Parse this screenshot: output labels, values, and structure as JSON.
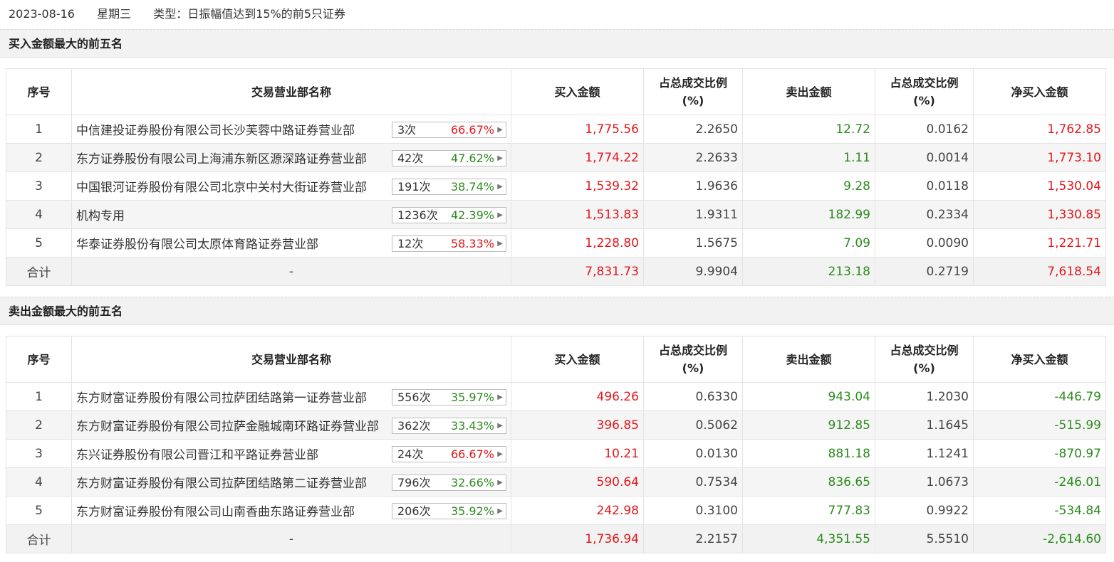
{
  "header": {
    "date": "2023-08-16",
    "weekday": "星期三",
    "type_text": "类型：日振幅值达到15%的前5只证券"
  },
  "columns": {
    "seq": "序号",
    "dept": "交易营业部名称",
    "buy_amt": "买入金额",
    "buy_ratio_l1": "占总成交比例",
    "buy_ratio_l2": "(%)",
    "sell_amt": "卖出金额",
    "sell_ratio_l1": "占总成交比例",
    "sell_ratio_l2": "(%)",
    "net": "净买入金额"
  },
  "buy_section": {
    "title": "买入金额最大的前五名",
    "rows": [
      {
        "seq": "1",
        "name": "中信建投证券股份有限公司长沙芙蓉中路证券营业部",
        "count": "3次",
        "pct": "66.67%",
        "pct_color": "red",
        "buy": "1,775.56",
        "buy_ratio": "2.2650",
        "sell": "12.72",
        "sell_ratio": "0.0162",
        "net": "1,762.85"
      },
      {
        "seq": "2",
        "name": "东方证券股份有限公司上海浦东新区源深路证券营业部",
        "count": "42次",
        "pct": "47.62%",
        "pct_color": "green",
        "buy": "1,774.22",
        "buy_ratio": "2.2633",
        "sell": "1.11",
        "sell_ratio": "0.0014",
        "net": "1,773.10"
      },
      {
        "seq": "3",
        "name": "中国银河证券股份有限公司北京中关村大街证券营业部",
        "count": "191次",
        "pct": "38.74%",
        "pct_color": "green",
        "buy": "1,539.32",
        "buy_ratio": "1.9636",
        "sell": "9.28",
        "sell_ratio": "0.0118",
        "net": "1,530.04"
      },
      {
        "seq": "4",
        "name": "机构专用",
        "count": "1236次",
        "pct": "42.39%",
        "pct_color": "green",
        "buy": "1,513.83",
        "buy_ratio": "1.9311",
        "sell": "182.99",
        "sell_ratio": "0.2334",
        "net": "1,330.85"
      },
      {
        "seq": "5",
        "name": "华泰证券股份有限公司太原体育路证券营业部",
        "count": "12次",
        "pct": "58.33%",
        "pct_color": "red",
        "buy": "1,228.80",
        "buy_ratio": "1.5675",
        "sell": "7.09",
        "sell_ratio": "0.0090",
        "net": "1,221.71"
      }
    ],
    "total": {
      "label": "合计",
      "name": "-",
      "buy": "7,831.73",
      "buy_ratio": "9.9904",
      "sell": "213.18",
      "sell_ratio": "0.2719",
      "net": "7,618.54"
    }
  },
  "sell_section": {
    "title": "卖出金额最大的前五名",
    "rows": [
      {
        "seq": "1",
        "name": "东方财富证券股份有限公司拉萨团结路第一证券营业部",
        "count": "556次",
        "pct": "35.97%",
        "pct_color": "green",
        "buy": "496.26",
        "buy_ratio": "0.6330",
        "sell": "943.04",
        "sell_ratio": "1.2030",
        "net": "-446.79"
      },
      {
        "seq": "2",
        "name": "东方财富证券股份有限公司拉萨金融城南环路证券营业部",
        "count": "362次",
        "pct": "33.43%",
        "pct_color": "green",
        "buy": "396.85",
        "buy_ratio": "0.5062",
        "sell": "912.85",
        "sell_ratio": "1.1645",
        "net": "-515.99"
      },
      {
        "seq": "3",
        "name": "东兴证券股份有限公司晋江和平路证券营业部",
        "count": "24次",
        "pct": "66.67%",
        "pct_color": "red",
        "buy": "10.21",
        "buy_ratio": "0.0130",
        "sell": "881.18",
        "sell_ratio": "1.1241",
        "net": "-870.97"
      },
      {
        "seq": "4",
        "name": "东方财富证券股份有限公司拉萨团结路第二证券营业部",
        "count": "796次",
        "pct": "32.66%",
        "pct_color": "green",
        "buy": "590.64",
        "buy_ratio": "0.7534",
        "sell": "836.65",
        "sell_ratio": "1.0673",
        "net": "-246.01"
      },
      {
        "seq": "5",
        "name": "东方财富证券股份有限公司山南香曲东路证券营业部",
        "count": "206次",
        "pct": "35.92%",
        "pct_color": "green",
        "buy": "242.98",
        "buy_ratio": "0.3100",
        "sell": "777.83",
        "sell_ratio": "0.9922",
        "net": "-534.84"
      }
    ],
    "total": {
      "label": "合计",
      "name": "-",
      "buy": "1,736.94",
      "buy_ratio": "2.2157",
      "sell": "4,351.55",
      "sell_ratio": "5.5510",
      "net": "-2,614.60"
    }
  },
  "colors": {
    "up": "#e4161a",
    "down": "#2d8b1e"
  },
  "icons": {
    "pill_arrow": "triangle-right-icon"
  }
}
